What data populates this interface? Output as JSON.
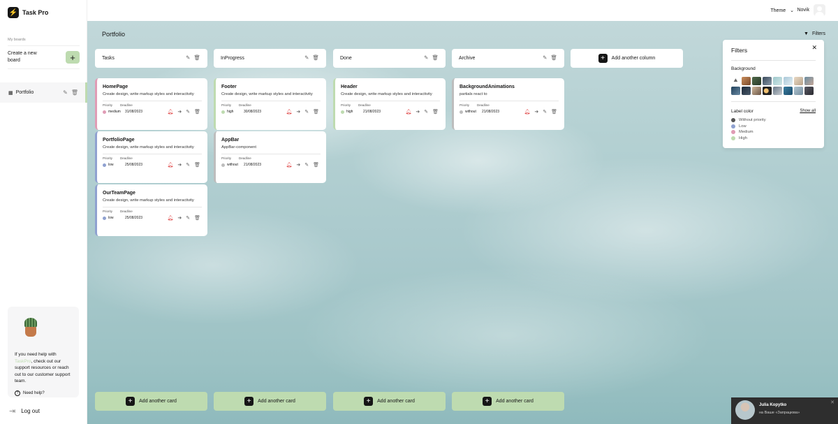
{
  "app": {
    "name": "Task Pro",
    "logo_glyph": "⚡"
  },
  "sidebar": {
    "my_boards_label": "My boards",
    "create_board_label": "Create a new board",
    "create_plus": "+",
    "boards": [
      {
        "label": "Portfolio"
      }
    ],
    "help": {
      "text_before": "If you need help with ",
      "brand": "TaskPro",
      "text_after": ", check out our support resources or reach out to our customer support team.",
      "need_help_label": "Need help?"
    },
    "logout_label": "Log out"
  },
  "header": {
    "theme_label": "Theme",
    "user_name": "Novik"
  },
  "board": {
    "title": "Portfolio",
    "filters_label": "Filters",
    "add_column_label": "Add another column",
    "columns": [
      {
        "title": "Tasks"
      },
      {
        "title": "InProgress"
      },
      {
        "title": "Done"
      },
      {
        "title": "Archive"
      }
    ],
    "add_card_label": "Add another card",
    "priority_label": "Priority",
    "deadline_label": "Deadline",
    "cards": [
      {
        "title": "HomePage",
        "description": "Create design, write markup styles and interactivity",
        "priority": "medium",
        "deadline": "31/08/2023"
      },
      {
        "title": "PortfolioPage",
        "description": "Create design, write markup styles and interactivity",
        "priority": "low",
        "deadline": "25/08/2023"
      },
      {
        "title": "OurTeamPage",
        "description": "Create design, write markup styles and interactivity",
        "priority": "low",
        "deadline": "25/08/2023"
      },
      {
        "title": "Footer",
        "description": "Create design, write markup styles and interactivity",
        "priority": "high",
        "deadline": "30/08/2023"
      },
      {
        "title": "AppBar",
        "description": "AppBar-component",
        "priority": "without",
        "deadline": "21/08/2023"
      },
      {
        "title": "Header",
        "description": "Create design, write markup styles and interactivity",
        "priority": "high",
        "deadline": "21/08/2023"
      },
      {
        "title": "BackgroundAnimations",
        "description": "partials react to",
        "priority": "without",
        "deadline": "21/08/2023"
      }
    ]
  },
  "filters": {
    "title": "Filters",
    "background_label": "Background",
    "label_color_label": "Label color",
    "show_all_label": "Show all",
    "labels": [
      {
        "name": "Without priority",
        "color": "#555555"
      },
      {
        "name": "Low",
        "color": "#8fa1d0"
      },
      {
        "name": "Medium",
        "color": "#e09cb5"
      },
      {
        "name": "High",
        "color": "#bedbb0"
      }
    ]
  },
  "notification": {
    "name": "Julia Kopytko",
    "message": "на Ваше «Запрацюва»"
  },
  "colors": {
    "accent": "#bedbb0",
    "low": "#8fa1d0",
    "medium": "#e09cb5",
    "high": "#bedbb0",
    "without": "#bdbdbd"
  }
}
